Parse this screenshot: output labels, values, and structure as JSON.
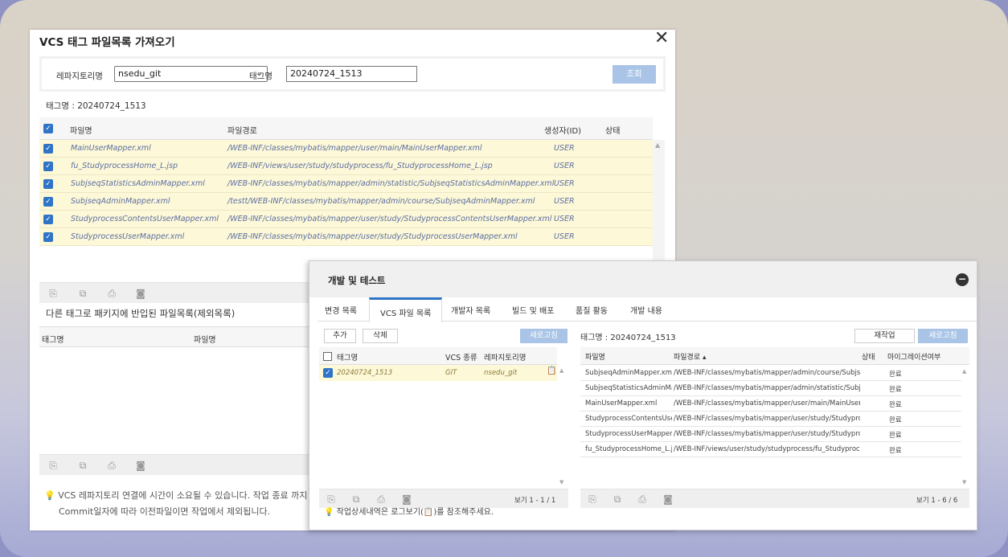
{
  "win1": {
    "title": "VCS 태그 파일목록 가져오기",
    "close": "✕",
    "search": {
      "repo_label": "레파지토리명",
      "repo_value": "nsedu_git",
      "tag_label": "태그명",
      "tag_value": "20240724_1513",
      "btn": "조회"
    },
    "tag_line": "태그명 : 20240724_1513",
    "grid": {
      "headers": [
        "파일명",
        "파일경로",
        "생성자(ID)",
        "상태"
      ],
      "rows": [
        {
          "name": "MainUserMapper.xml",
          "path": "/WEB-INF/classes/mybatis/mapper/user/main/MainUserMapper.xml",
          "creator": "USER"
        },
        {
          "name": "fu_StudyprocessHome_L.jsp",
          "path": "/WEB-INF/views/user/study/studyprocess/fu_StudyprocessHome_L.jsp",
          "creator": "USER"
        },
        {
          "name": "SubjseqStatisticsAdminMapper.xml",
          "path": "/WEB-INF/classes/mybatis/mapper/admin/statistic/SubjseqStatisticsAdminMapper.xml",
          "creator": "USER"
        },
        {
          "name": "SubjseqAdminMapper.xml",
          "path": "/testt/WEB-INF/classes/mybatis/mapper/admin/course/SubjseqAdminMapper.xml",
          "creator": "USER"
        },
        {
          "name": "StudyprocessContentsUserMapper.xml",
          "path": "/WEB-INF/classes/mybatis/mapper/user/study/StudyprocessContentsUserMapper.xml",
          "creator": "USER"
        },
        {
          "name": "StudyprocessUserMapper.xml",
          "path": "/WEB-INF/classes/mybatis/mapper/user/study/StudyprocessUserMapper.xml",
          "creator": "USER"
        }
      ]
    },
    "section2_title": "다른 태그로 패키지에 반입된 파일목록(제외목록)",
    "grid2_headers": [
      "태그명",
      "파일명"
    ],
    "note_line1": "VCS 레파지토리 연결에 시간이 소요될 수 있습니다. 작업 종료 까지",
    "note_line2": "Commit일자에 따라 이전파일이면 작업에서 제외됩니다."
  },
  "win2": {
    "title": "개발 및 테스트",
    "tabs": [
      "변경 목록",
      "VCS 파일 목록",
      "개발자 목록",
      "빌드 및 배포",
      "품질 활동",
      "개발 내용"
    ],
    "active_tab": "VCS 파일 목록",
    "left": {
      "add_btn": "추가",
      "del_btn": "삭제",
      "refresh_btn": "새로고침",
      "headers": [
        "태그명",
        "VCS 종류",
        "레파지토리명"
      ],
      "row": {
        "tag": "20240724_1513",
        "vcs": "GIT",
        "repo": "nsedu_git"
      },
      "pager": "보기 1 - 1 / 1"
    },
    "right": {
      "tag_line": "태그명 : 20240724_1513",
      "rework_btn": "재작업",
      "refresh_btn": "새로고침",
      "headers": [
        "파일명",
        "파일경로 ▴",
        "상태",
        "마이그레이션여부"
      ],
      "rows": [
        {
          "name": "SubjseqAdminMapper.xml",
          "path": "/WEB-INF/classes/mybatis/mapper/admin/course/SubjseqAd",
          "status": "완료"
        },
        {
          "name": "SubjseqStatisticsAdminMap",
          "path": "/WEB-INF/classes/mybatis/mapper/admin/statistic/SubjseqSt",
          "status": "완료"
        },
        {
          "name": "MainUserMapper.xml",
          "path": "/WEB-INF/classes/mybatis/mapper/user/main/MainUserMapp",
          "status": "완료"
        },
        {
          "name": "StudyprocessContentsUserM",
          "path": "/WEB-INF/classes/mybatis/mapper/user/study/StudyprocessC",
          "status": "완료"
        },
        {
          "name": "StudyprocessUserMapper.xr",
          "path": "/WEB-INF/classes/mybatis/mapper/user/study/StudyprocessU",
          "status": "완료"
        },
        {
          "name": "fu_StudyprocessHome_L.jsp",
          "path": "/WEB-INF/views/user/study/studyprocess/fu_StudyprocessHo",
          "status": "완료"
        }
      ],
      "pager": "보기 1 - 6 / 6"
    },
    "note": "작업상세내역은 로그보기(📋)를 참조해주세요."
  }
}
